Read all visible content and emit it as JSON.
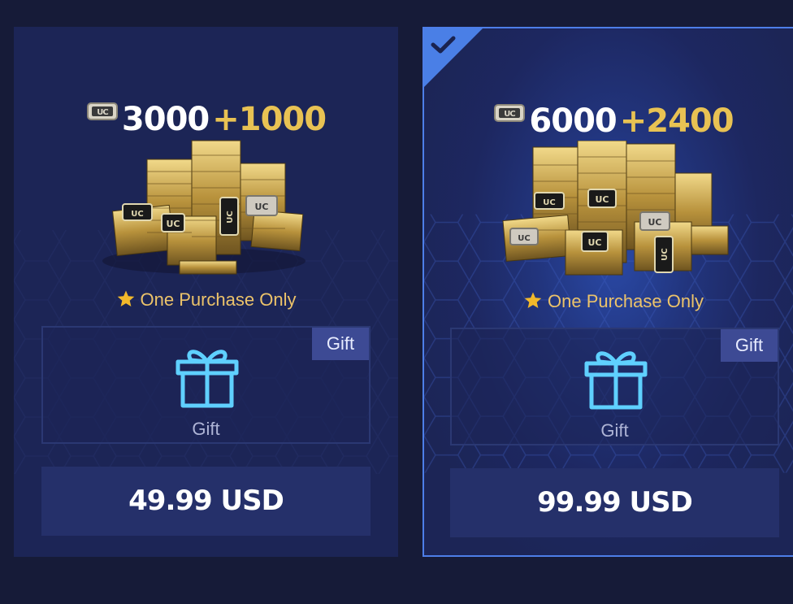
{
  "packages": [
    {
      "base_amount": "3000",
      "bonus_amount": "+1000",
      "currency_icon": "uc-badge-icon",
      "limit_text": "One Purchase Only",
      "gift_tag": "Gift",
      "gift_label": "Gift",
      "price": "49.99 USD",
      "selected": false
    },
    {
      "base_amount": "6000",
      "bonus_amount": "+2400",
      "currency_icon": "uc-badge-icon",
      "limit_text": "One Purchase Only",
      "gift_tag": "Gift",
      "gift_label": "Gift",
      "price": "99.99 USD",
      "selected": true
    }
  ],
  "colors": {
    "background": "#161b38",
    "card": "#1c2556",
    "selected_border": "#4d7ee8",
    "bonus": "#e8c253",
    "limit_text": "#ecc36a",
    "gift_icon": "#5fd0ff",
    "price_button": "#25306a",
    "gift_tag": "#3d4a94"
  }
}
